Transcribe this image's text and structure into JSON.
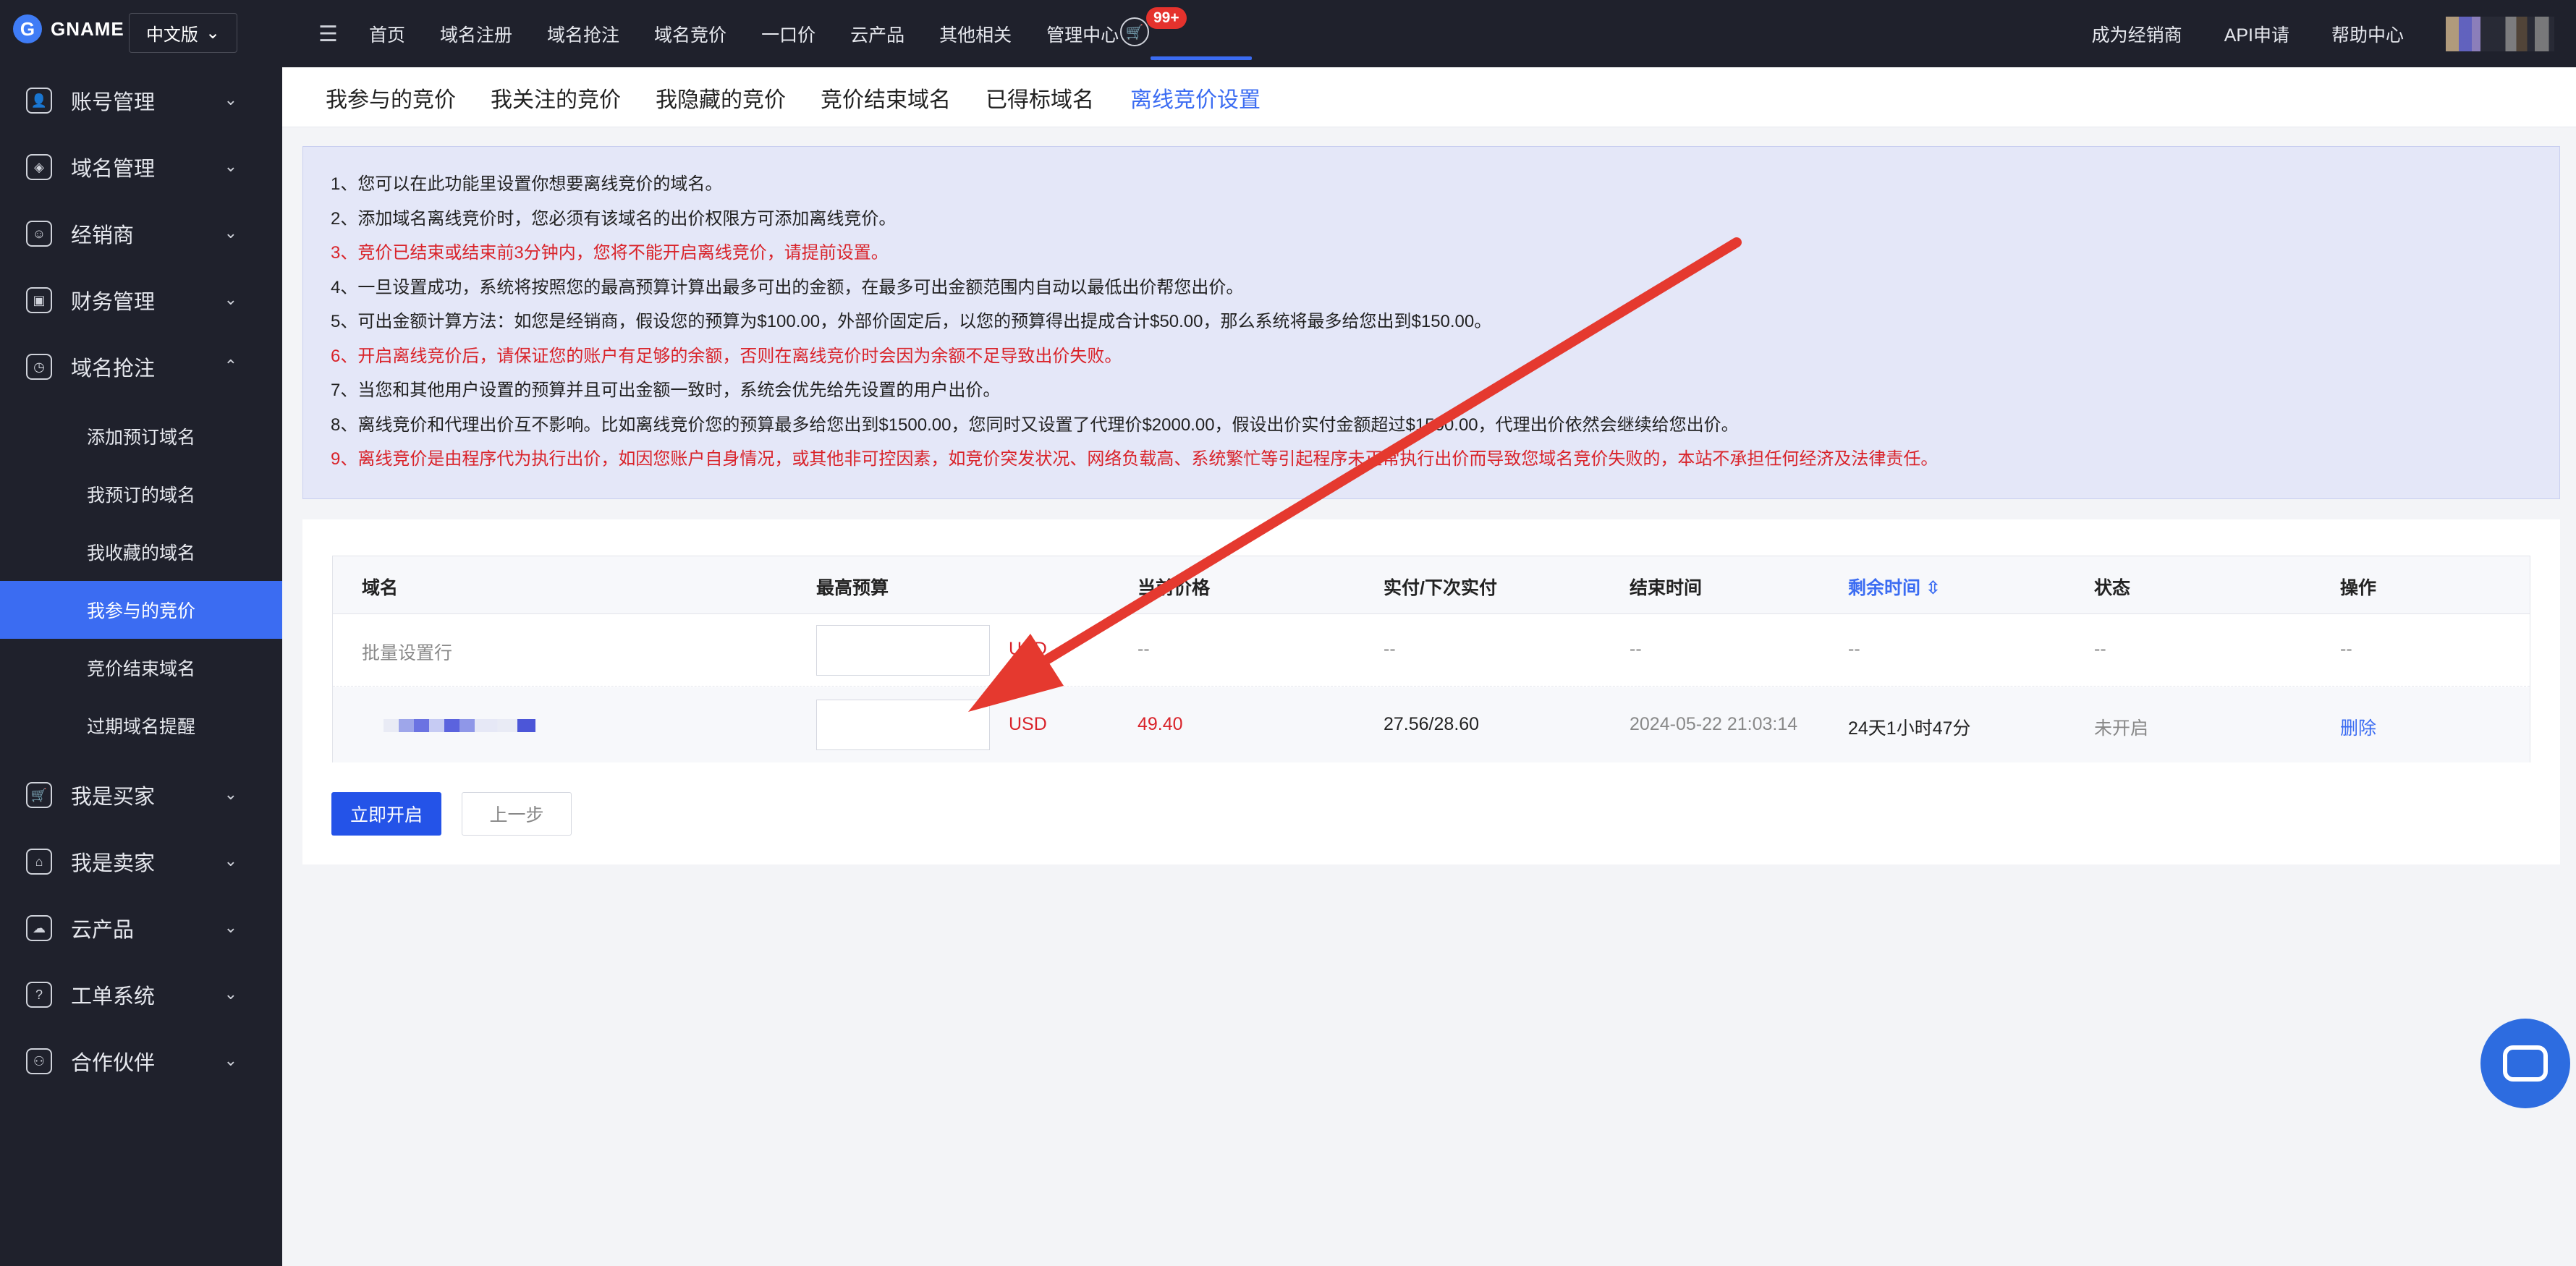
{
  "topbar": {
    "brand": "GNAME",
    "language": "中文版",
    "nav": [
      "首页",
      "域名注册",
      "域名抢注",
      "域名竞价",
      "一口价",
      "云产品",
      "其他相关",
      "管理中心"
    ],
    "cart_badge": "99+",
    "right_links": [
      "成为经销商",
      "API申请",
      "帮助中心"
    ]
  },
  "sidebar": {
    "groups_top": [
      {
        "label": "账号管理",
        "icon": "user-icon"
      },
      {
        "label": "域名管理",
        "icon": "layers-icon"
      },
      {
        "label": "经销商",
        "icon": "dealer-icon"
      },
      {
        "label": "财务管理",
        "icon": "wallet-icon"
      },
      {
        "label": "域名抢注",
        "icon": "clock-icon"
      }
    ],
    "subitems": [
      "添加预订域名",
      "我预订的域名",
      "我收藏的域名",
      "我参与的竞价",
      "竞价结束域名",
      "过期域名提醒"
    ],
    "active_sub": "我参与的竞价",
    "groups_bottom": [
      {
        "label": "我是买家",
        "icon": "basket-icon"
      },
      {
        "label": "我是卖家",
        "icon": "store-icon"
      },
      {
        "label": "云产品",
        "icon": "cloud-icon"
      },
      {
        "label": "工单系统",
        "icon": "help-icon"
      },
      {
        "label": "合作伙伴",
        "icon": "partner-icon"
      }
    ]
  },
  "tabs": [
    "我参与的竞价",
    "我关注的竞价",
    "我隐藏的竞价",
    "竞价结束域名",
    "已得标域名",
    "离线竞价设置"
  ],
  "active_tab": "离线竞价设置",
  "notice": [
    {
      "text": "1、您可以在此功能里设置你想要离线竞价的域名。",
      "red": false
    },
    {
      "text": "2、添加域名离线竞价时，您必须有该域名的出价权限方可添加离线竞价。",
      "red": false
    },
    {
      "text": "3、竞价已结束或结束前3分钟内，您将不能开启离线竞价，请提前设置。",
      "red": true
    },
    {
      "text": "4、一旦设置成功，系统将按照您的最高预算计算出最多可出的金额，在最多可出金额范围内自动以最低出价帮您出价。",
      "red": false
    },
    {
      "text": "5、可出金额计算方法：如您是经销商，假设您的预算为$100.00，外部价固定后，以您的预算得出提成合计$50.00，那么系统将最多给您出到$150.00。",
      "red": false
    },
    {
      "text": "6、开启离线竞价后，请保证您的账户有足够的余额，否则在离线竞价时会因为余额不足导致出价失败。",
      "red": true
    },
    {
      "text": "7、当您和其他用户设置的预算并且可出金额一致时，系统会优先给先设置的用户出价。",
      "red": false
    },
    {
      "text": "8、离线竞价和代理出价互不影响。比如离线竞价您的预算最多给您出到$1500.00，您同时又设置了代理价$2000.00，假设出价实付金额超过$1500.00，代理出价依然会继续给您出价。",
      "red": false
    },
    {
      "text": "9、离线竞价是由程序代为执行出价，如因您账户自身情况，或其他非可控因素，如竞价突发状况、网络负载高、系统繁忙等引起程序未正常执行出价而导致您域名竞价失败的，本站不承担任何经济及法律责任。",
      "red": true
    }
  ],
  "table": {
    "headers": [
      "域名",
      "最高预算",
      "当前价格",
      "实付/下次实付",
      "结束时间",
      "剩余时间",
      "状态",
      "操作"
    ],
    "batch_row": {
      "label": "批量设置行",
      "currency": "USD",
      "placeholder": "--"
    },
    "row": {
      "currency": "USD",
      "current_price": "49.40",
      "paid": "27.56/28.60",
      "end_time": "2024-05-22 21:03:14",
      "remaining": "24天1小时47分",
      "status": "未开启",
      "action": "删除"
    }
  },
  "buttons": {
    "start": "立即开启",
    "back": "上一步"
  },
  "colors": {
    "accent": "#3b6cf2",
    "red": "#d9232a",
    "sidebar": "#1f212c"
  }
}
